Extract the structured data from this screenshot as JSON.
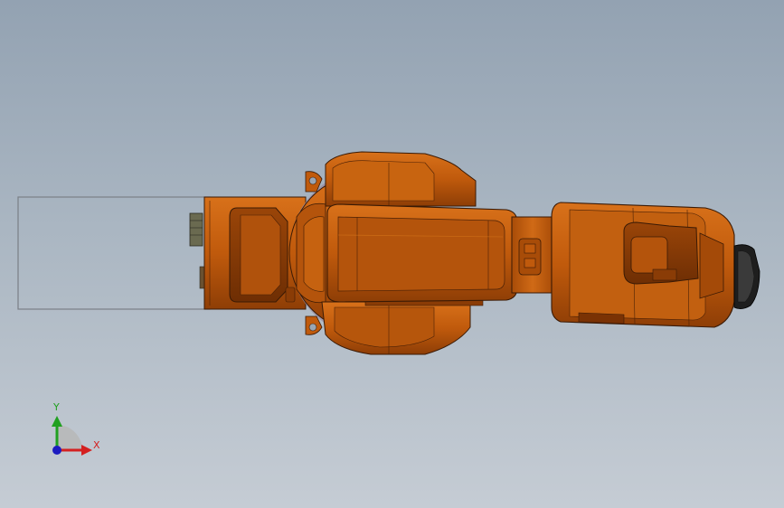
{
  "viewport": {
    "background_top": "#93a2b2",
    "background_bottom": "#c5ccd4"
  },
  "model": {
    "part_name": "robot-arm",
    "body_color": "#c8620f",
    "shadow_color": "#8a3c06",
    "outline_color": "#3a1a05",
    "base_color": "#6a6a50",
    "flange_color": "#1e1e1e"
  },
  "triad": {
    "x_label": "X",
    "y_label": "Y",
    "x_color": "#d42020",
    "y_color": "#20a020",
    "z_color": "#1c1cc0"
  }
}
